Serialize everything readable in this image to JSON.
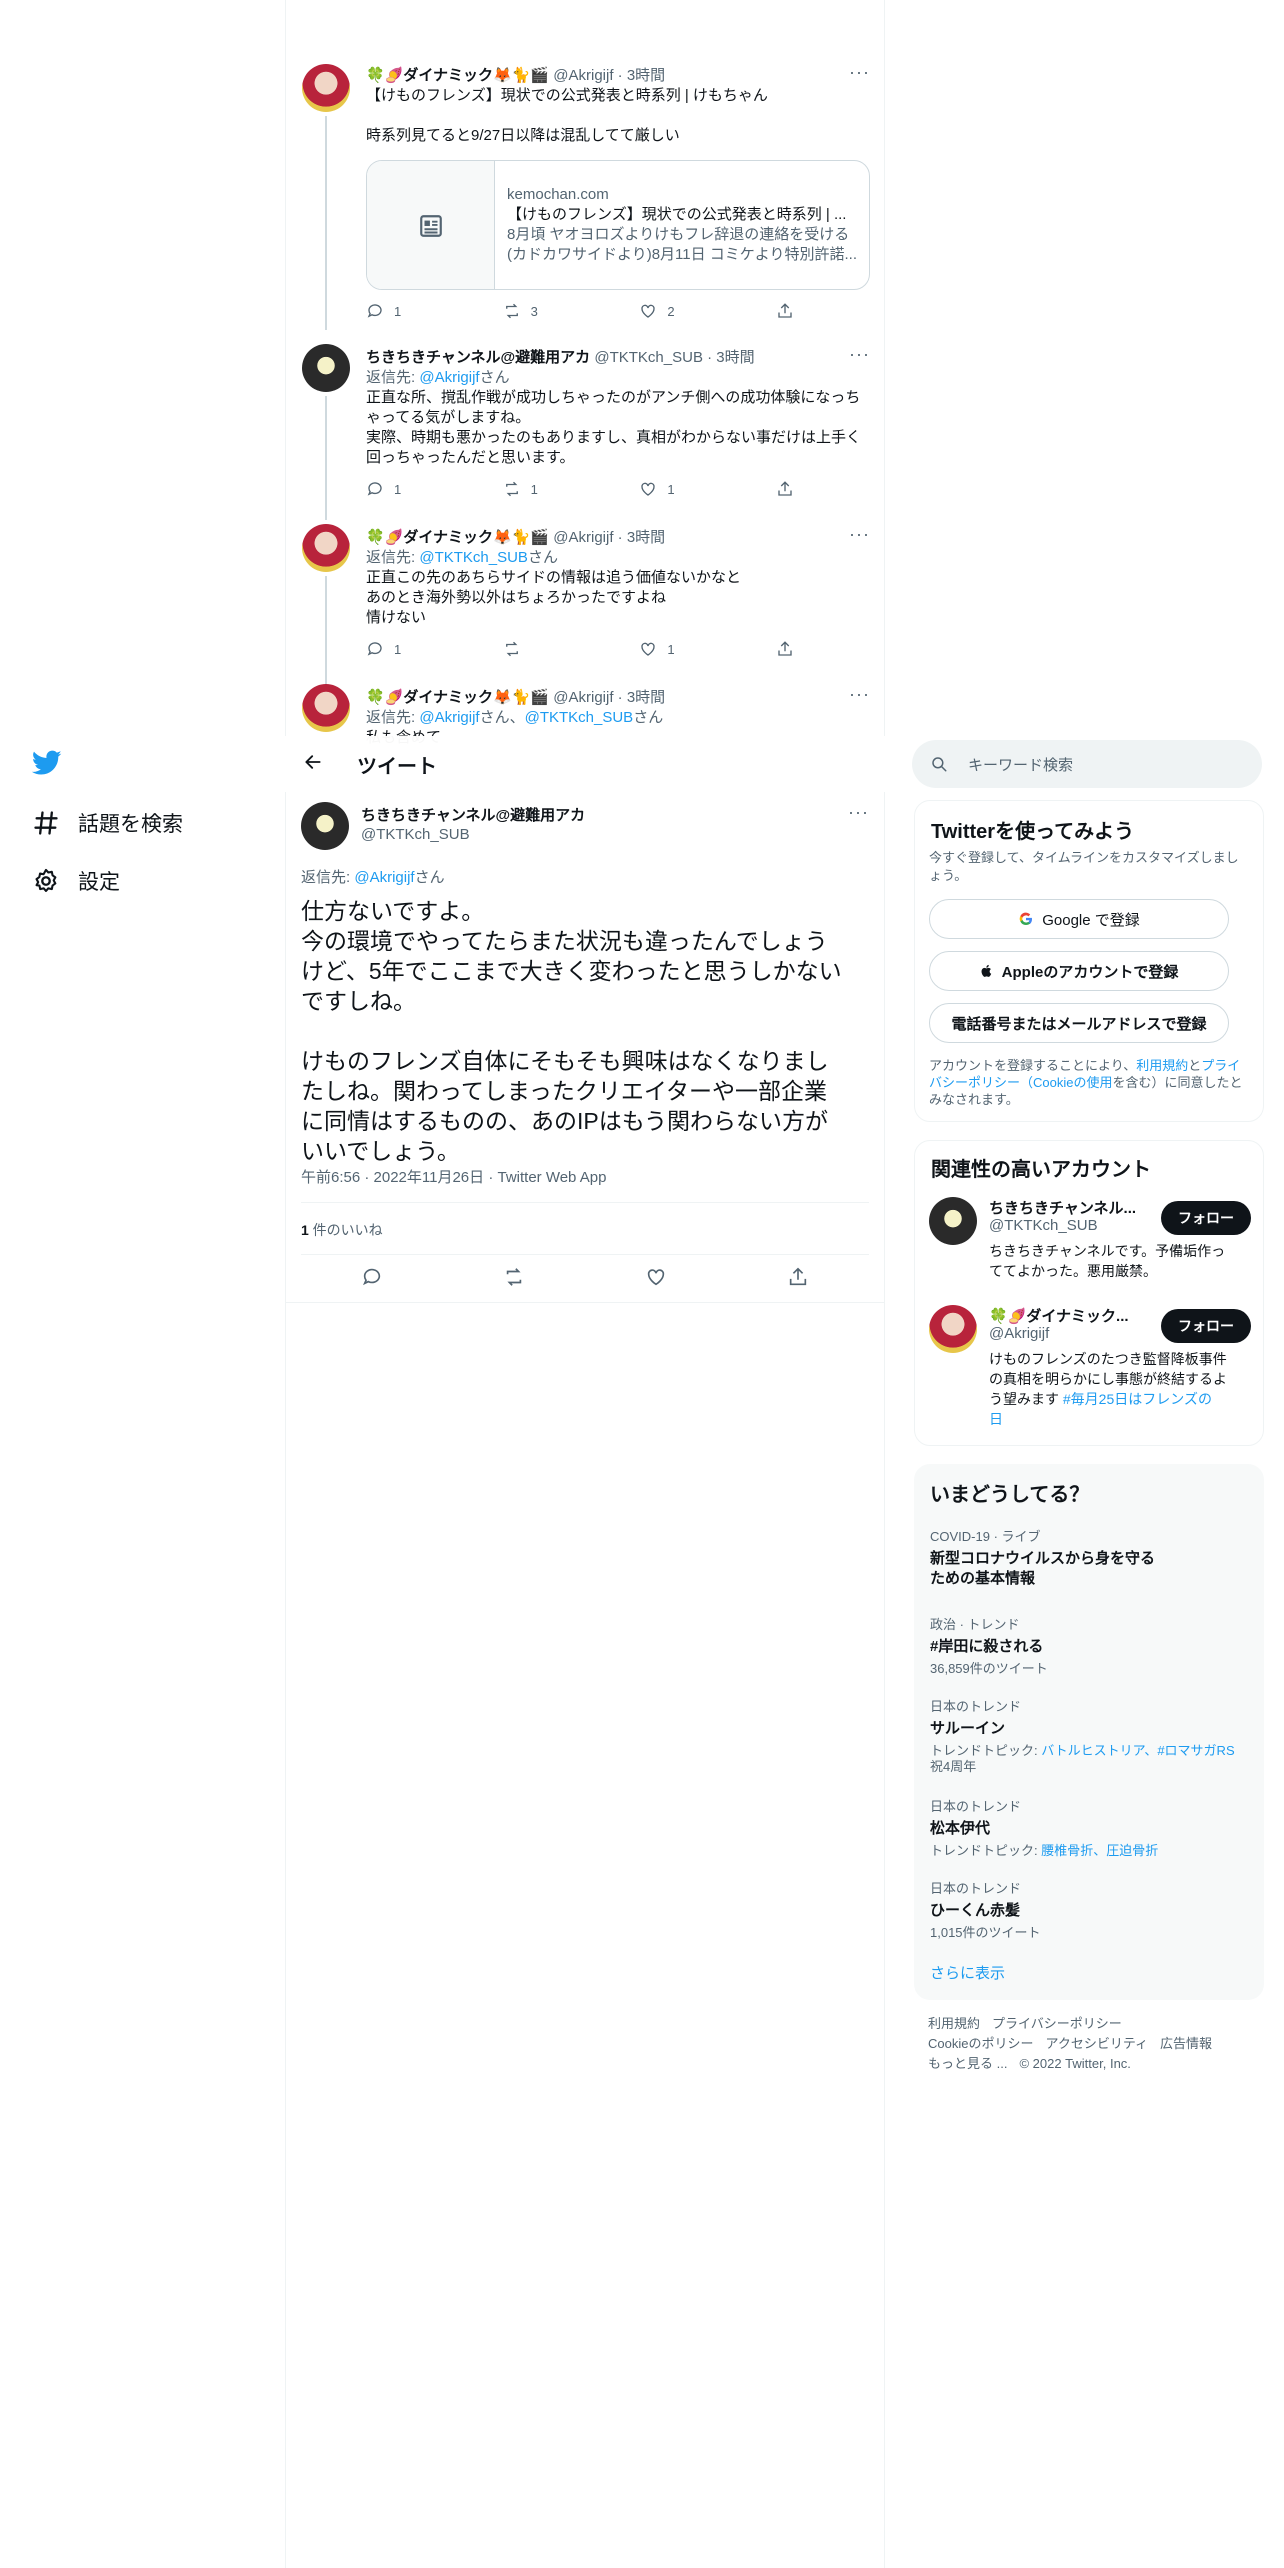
{
  "colors": {
    "accent": "#1d9bf0",
    "text": "#0f1419",
    "muted": "#536471",
    "border": "#eff3f4"
  },
  "nav": {
    "explore": "話題を検索",
    "settings": "設定"
  },
  "thread": [
    {
      "name": "🍀🍠ダイナミック🦊🐈🎬",
      "handle": "@Akrigijf",
      "time": "3時間",
      "text": "【けものフレンズ】現状での公式発表と時系列 | けもちゃん",
      "text2": "時系列見てると9/27日以降は混乱してて厳しい",
      "card": {
        "domain": "kemochan.com",
        "title": "【けものフレンズ】現状での公式発表と時系列 | ...",
        "desc1": "8月頃 ヤオヨロズよりけもフレ辞退の連絡を受ける",
        "desc2": "(カドカワサイドより)8月11日 コミケより特別許諾..."
      },
      "replies": "1",
      "retweets": "3",
      "likes": "2"
    },
    {
      "name": "ちきちきチャンネル@避難用アカ",
      "handle": "@TKTKch_SUB",
      "time": "3時間",
      "reply_prefix": "返信先: ",
      "reply_to": "@Akrigijf",
      "reply_suffix": "さん",
      "lines": [
        "正直な所、撹乱作戦が成功しちゃったのがアンチ側への成功体験になっち",
        "ゃってる気がしますね。",
        "実際、時期も悪かったのもありますし、真相がわからない事だけは上手く",
        "回っちゃったんだと思います。"
      ],
      "replies": "1",
      "retweets": "1",
      "likes": "1"
    },
    {
      "name": "🍀🍠ダイナミック🦊🐈🎬",
      "handle": "@Akrigijf",
      "time": "3時間",
      "reply_prefix": "返信先: ",
      "reply_to": "@TKTKch_SUB",
      "reply_suffix": "さん",
      "lines": [
        "正直この先のあちらサイドの情報は追う価値ないかなと",
        "あのとき海外勢以外はちょろかったですよね",
        "情けない"
      ],
      "replies": "1",
      "retweets": "",
      "likes": "1"
    },
    {
      "name": "🍀🍠ダイナミック🦊🐈🎬",
      "handle": "@Akrigijf",
      "time": "3時間",
      "reply_prefix": "返信先: ",
      "reply_to": "@Akrigijf",
      "reply_mid": "さん、",
      "reply_to2": "@TKTKch_SUB",
      "reply_suffix": "さん",
      "partial": "私も含めて"
    }
  ],
  "header": {
    "title": "ツイート"
  },
  "main_tweet": {
    "name": "ちきちきチャンネル@避難用アカ",
    "handle": "@TKTKch_SUB",
    "reply_prefix": "返信先: ",
    "reply_to": "@Akrigijf",
    "reply_suffix": "さん",
    "paragraph1": [
      "仕方ないですよ。",
      "今の環境でやってたらまた状況も違ったんでしょう",
      "けど、5年でここまで大きく変わったと思うしかない",
      "ですしね。"
    ],
    "paragraph2": [
      "けものフレンズ自体にそもそも興味はなくなりまし",
      "たしね。関わってしまったクリエイターや一部企業",
      "に同情はするものの、あのIPはもう関わらない方が",
      "いいでしょう。"
    ],
    "timestamp": "午前6:56 · 2022年11月26日 · Twitter Web App",
    "likes_count": "1",
    "likes_label": " 件のいいね"
  },
  "search": {
    "placeholder": "キーワード検索"
  },
  "signup": {
    "title": "Twitterを使ってみよう",
    "subtitle": "今すぐ登録して、タイムラインをカスタマイズしましょう。",
    "google": "Google で登録",
    "apple": "Appleのアカウントで登録",
    "phone": "電話番号またはメールアドレスで登録",
    "legal1": "アカウントを登録することにより、",
    "legal_terms": "利用規約",
    "legal_and": "と",
    "legal_privacy": "プライバシーポリシー（Cookieの使用",
    "legal2": "を含む）に同意したとみなされます。"
  },
  "related": {
    "title": "関連性の高いアカウント",
    "accounts": [
      {
        "name": "ちきちきチャンネル...",
        "handle": "@TKTKch_SUB",
        "follow": "フォロー",
        "bio1": "ちきちきチャンネルです。予備垢作っ",
        "bio2": "ててよかった。悪用厳禁。"
      },
      {
        "name": "🍀🍠ダイナミック...",
        "handle": "@Akrigijf",
        "follow": "フォロー",
        "bio1": "けものフレンズのたつき監督降板事件",
        "bio2": "の真相を明らかにし事態が終結するよ",
        "bio3": "う望みます ",
        "bio_tag1": "#毎月25日はフレンズの",
        "bio_tag2": "日"
      }
    ]
  },
  "trends": {
    "title": "いまどうしてる？",
    "items": [
      {
        "cat": "COVID-19 · ライブ",
        "title1": "新型コロナウイルスから身を守る",
        "title2": "ための基本情報"
      },
      {
        "cat": "政治 · トレンド",
        "title1": "#岸田に殺される",
        "meta": "36,859件のツイート"
      },
      {
        "cat": "日本のトレンド",
        "title1": "サルーイン",
        "meta_prefix": "トレンドトピック: ",
        "meta_links1": "バトルヒストリア、#ロマサガRS",
        "meta_links2": "祝4周年"
      },
      {
        "cat": "日本のトレンド",
        "title1": "松本伊代",
        "meta_prefix": "トレンドトピック: ",
        "meta_links1": "腰椎骨折、圧迫骨折"
      },
      {
        "cat": "日本のトレンド",
        "title1": "ひーくん赤髪",
        "meta": "1,015件のツイート"
      }
    ],
    "show_more": "さらに表示"
  },
  "footer": {
    "terms": "利用規約",
    "privacy": "プライバシーポリシー",
    "cookie": "Cookieのポリシー",
    "accessibility": "アクセシビリティ",
    "ads": "広告情報",
    "more": "もっと見る ...",
    "copyright": "© 2022 Twitter, Inc."
  }
}
